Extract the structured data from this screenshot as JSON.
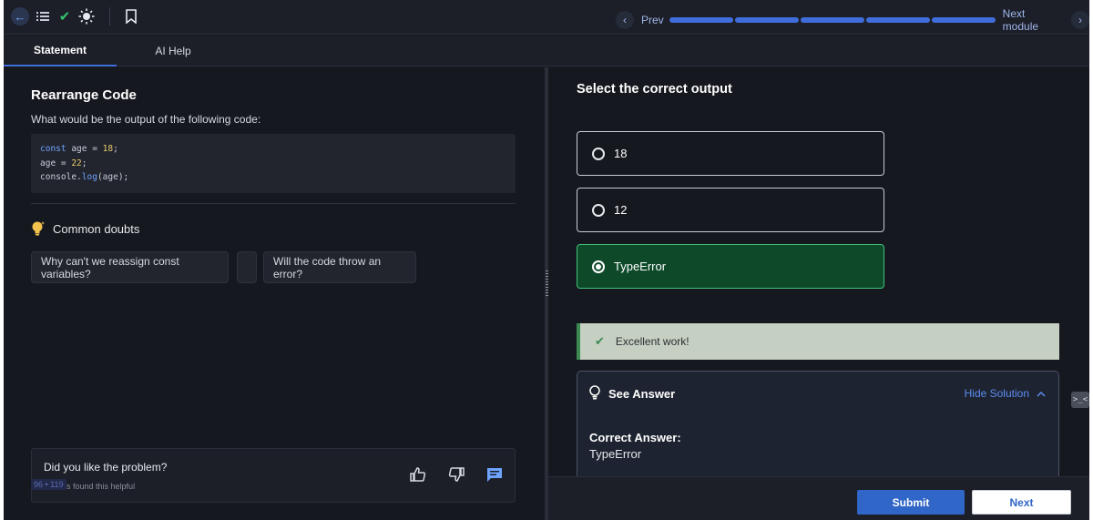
{
  "topbar": {
    "back_icon": "arrow-left-icon",
    "list_icon": "list-icon",
    "check_icon": "check-icon",
    "theme_icon": "sun-icon",
    "bookmark_icon": "bookmark-icon",
    "prev_label": "Prev",
    "next_module_label": "Next module",
    "progress_segments": 5,
    "progress_color": "#3f6ddb"
  },
  "tabs": [
    {
      "label": "Statement",
      "active": true
    },
    {
      "label": "AI Help",
      "active": false
    }
  ],
  "problem": {
    "title": "Rearrange Code",
    "description": "What would be the output of the following code:",
    "code_lines": [
      "const age = 18;",
      "age = 22;",
      "console.log(age);"
    ]
  },
  "doubts": {
    "header": "Common doubts",
    "chips": [
      "Why can't we reassign const variables?",
      "",
      "Will the code throw an error?"
    ]
  },
  "feedback": {
    "question": "Did you like the problem?",
    "helpful_text": "4 users found this helpful",
    "badge": "96 • 119"
  },
  "question": {
    "title": "Select the correct output",
    "options": [
      {
        "label": "18",
        "selected": false
      },
      {
        "label": "12",
        "selected": false
      },
      {
        "label": "TypeError",
        "selected": true
      }
    ]
  },
  "result": {
    "message": "Excellent work!",
    "color": "#3b8a52"
  },
  "answer": {
    "header": "See Answer",
    "toggle": "Hide Solution",
    "label": "Correct Answer:",
    "value": "TypeError"
  },
  "actions": {
    "submit": "Submit",
    "next": "Next"
  },
  "side_widget": ">_<"
}
